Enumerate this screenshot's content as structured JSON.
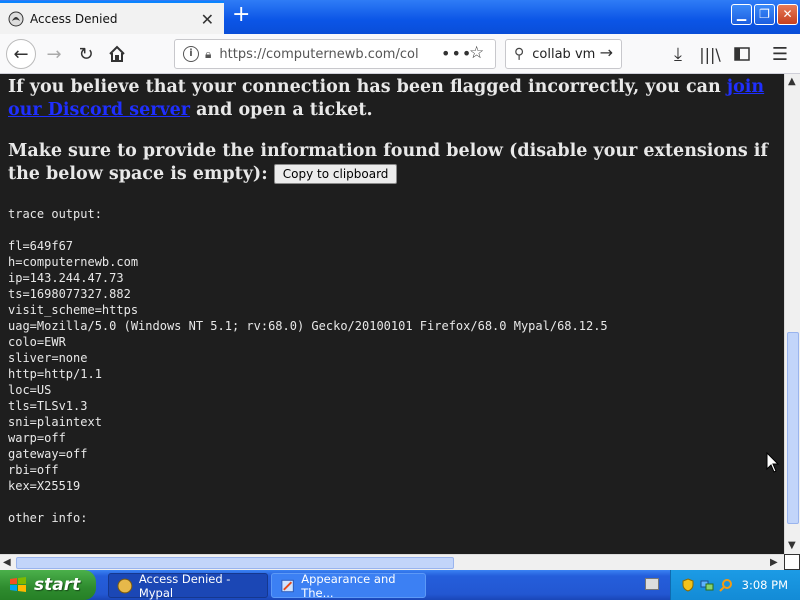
{
  "browser": {
    "tab_title": "Access Denied",
    "new_tab": "+",
    "url": "https://computernewb.com/col",
    "search_text": "collab vm",
    "urlbar_dots": "•••"
  },
  "content": {
    "para1_before": "If you believe that your connection has been flagged incorrectly, you can ",
    "para1_link": "join our Discord server",
    "para1_after": " and open a ticket.",
    "para2_text": "Make sure to provide the information found below (disable your extensions if the below space is empty): ",
    "copy_button": "Copy to clipboard",
    "trace_lines": [
      "trace output:",
      "",
      "fl=649f67",
      "h=computernewb.com",
      "ip=143.244.47.73",
      "ts=1698077327.882",
      "visit_scheme=https",
      "uag=Mozilla/5.0 (Windows NT 5.1; rv:68.0) Gecko/20100101 Firefox/68.0 Mypal/68.12.5",
      "colo=EWR",
      "sliver=none",
      "http=http/1.1",
      "loc=US",
      "tls=TLSv1.3",
      "sni=plaintext",
      "warp=off",
      "gateway=off",
      "rbi=off",
      "kex=X25519",
      "",
      "other info:"
    ]
  },
  "taskbar": {
    "start_label": "start",
    "items": [
      {
        "label": "Access Denied - Mypal"
      },
      {
        "label": "Appearance and The..."
      }
    ],
    "clock": "3:08 PM"
  },
  "colors": {
    "page_background": "#1e1e1e",
    "link": "#1f2fff",
    "titlebar": "#0b55e6",
    "taskbar": "#245edb",
    "start_button": "#2e8b2e"
  },
  "scroll": {
    "vertical_position": 0.6,
    "horizontal_position": 0.0
  }
}
